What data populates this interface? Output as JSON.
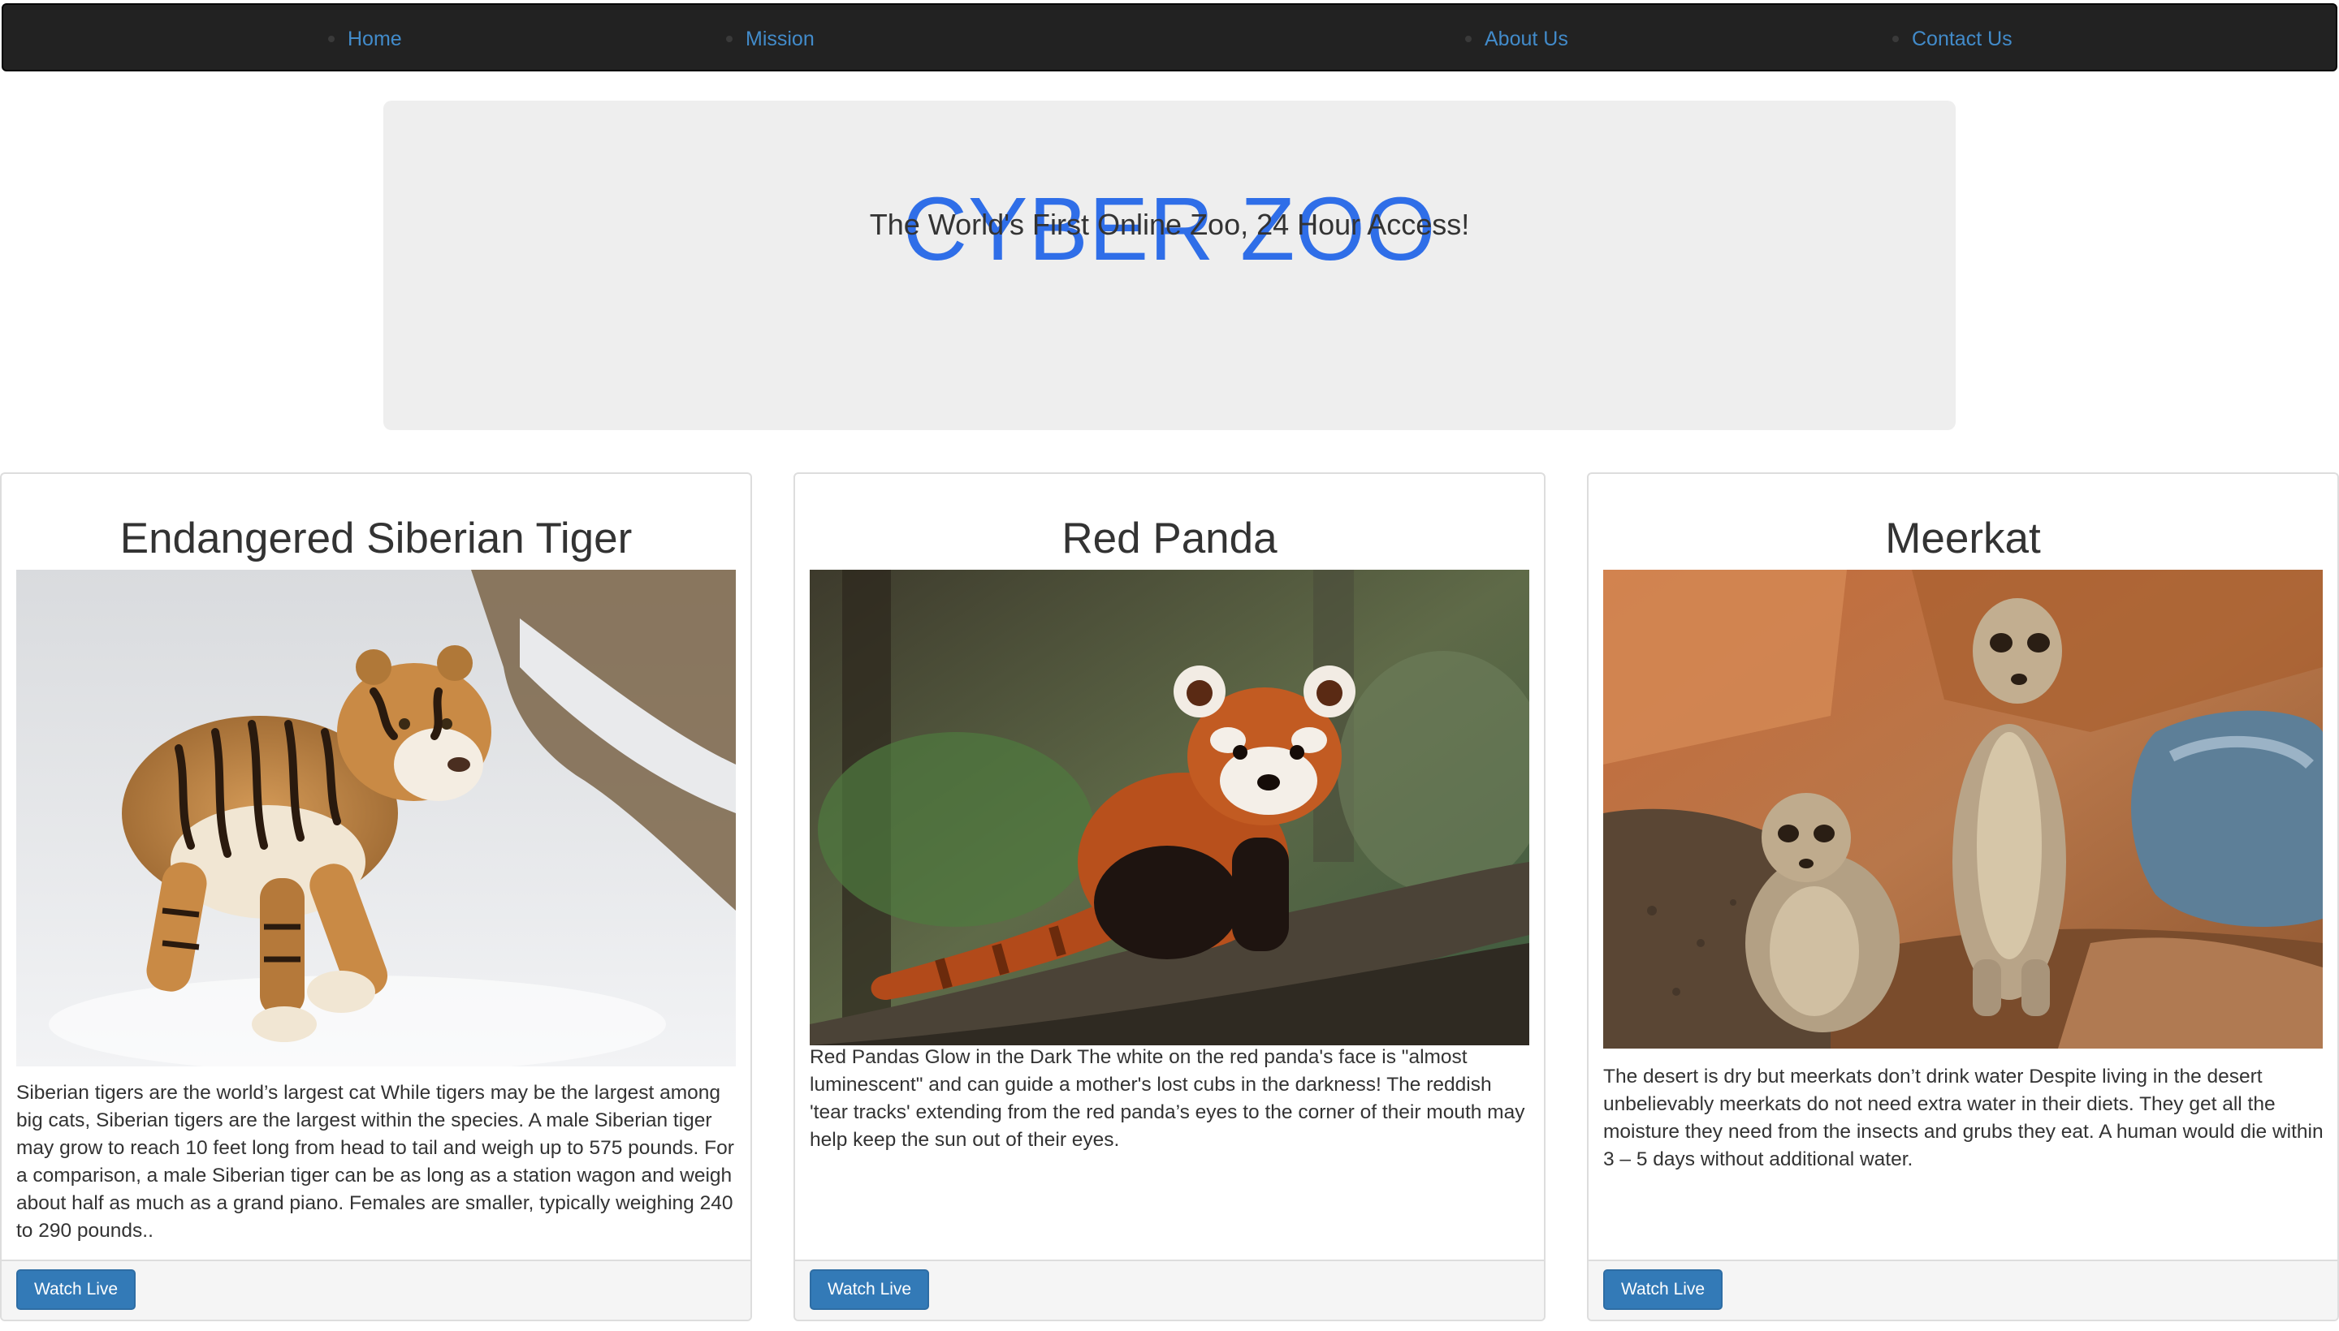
{
  "nav": {
    "items": [
      {
        "label": "Home"
      },
      {
        "label": "Mission"
      },
      {
        "label": "About Us"
      },
      {
        "label": "Contact Us"
      }
    ]
  },
  "hero": {
    "title": "CYBER ZOO",
    "subtitle": "The World's First Online Zoo, 24 Hour Access!"
  },
  "cards": [
    {
      "title": "Endangered Siberian Tiger",
      "image_icon": "tiger-photo",
      "description": "Siberian tigers are the world’s largest cat While tigers may be the largest among big cats, Siberian tigers are the largest within the species. A male Siberian tiger may grow to reach 10 feet long from head to tail and weigh up to 575 pounds. For a comparison, a male Siberian tiger can be as long as a station wagon and weigh about half as much as a grand piano. Females are smaller, typically weighing 240 to 290 pounds..",
      "button_label": "Watch Live"
    },
    {
      "title": "Red Panda",
      "image_icon": "red-panda-photo",
      "description": "Red Pandas Glow in the Dark The white on the red panda's face is \"almost luminescent\" and can guide a mother's lost cubs in the darkness! The reddish 'tear tracks' extending from the red panda’s eyes to the corner of their mouth may help keep the sun out of their eyes.",
      "button_label": "Watch Live"
    },
    {
      "title": "Meerkat",
      "image_icon": "meerkat-photo",
      "description": "The desert is dry but meerkats don’t drink water Despite living in the desert unbelievably meerkats do not need extra water in their diets. They get all the moisture they need from the insects and grubs they eat. A human would die within 3 – 5 days without additional water.",
      "button_label": "Watch Live"
    }
  ],
  "colors": {
    "navbar_bg": "#222222",
    "link": "#428bca",
    "hero_title": "#2f6ee8",
    "button": "#337ab7"
  }
}
